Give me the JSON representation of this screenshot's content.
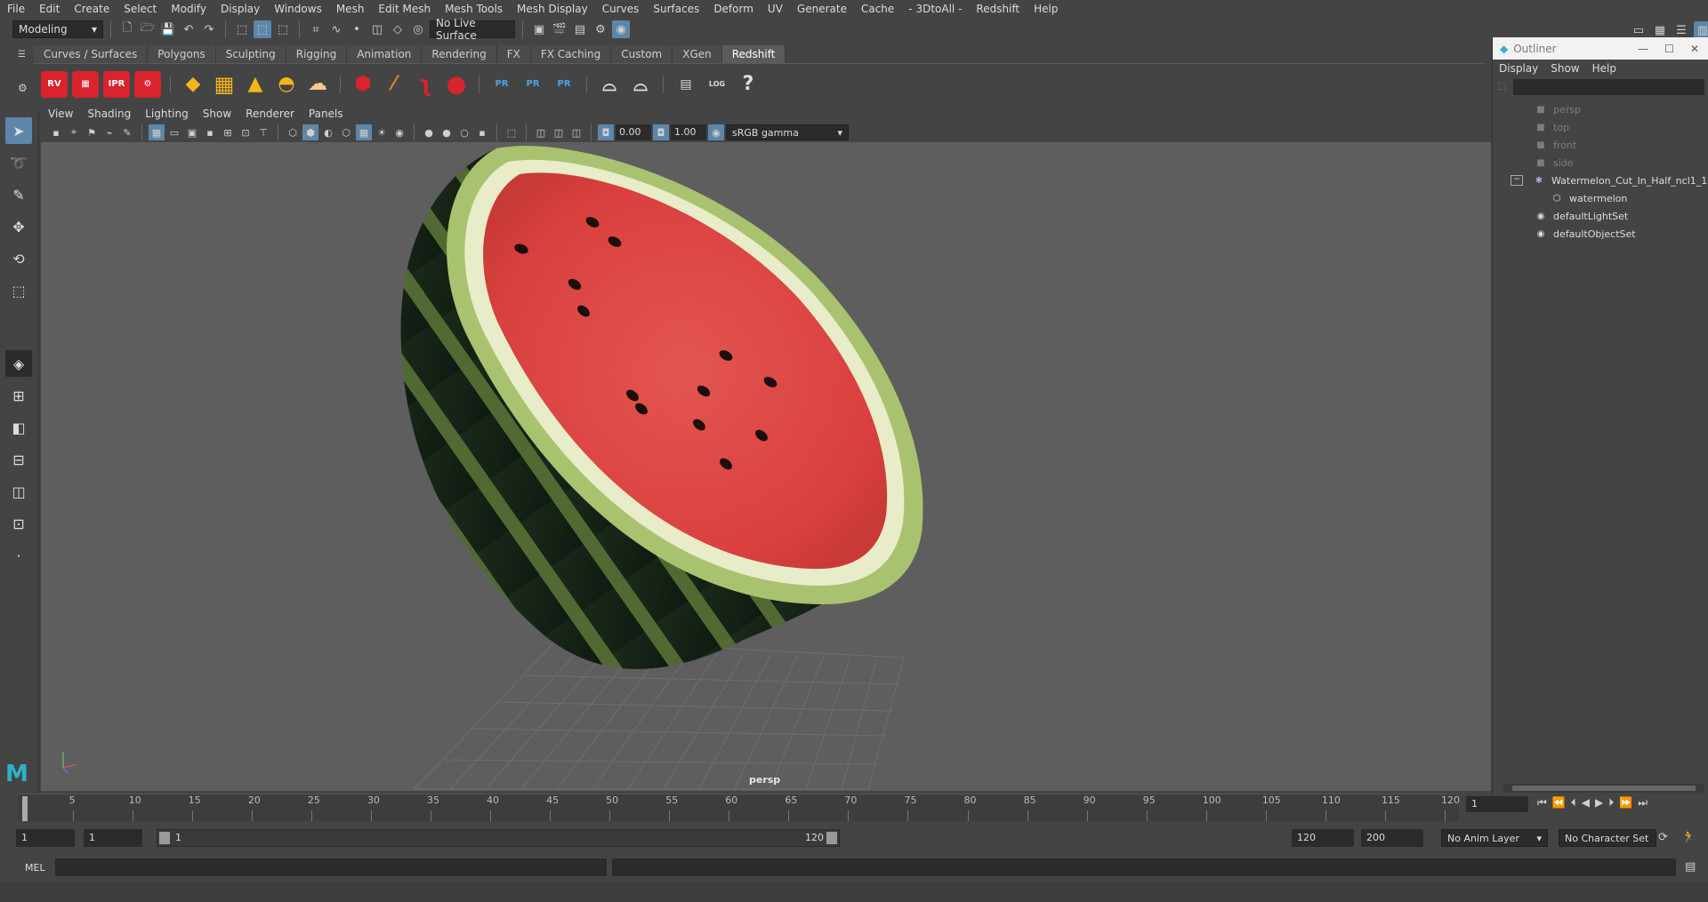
{
  "menubar": [
    "File",
    "Edit",
    "Create",
    "Select",
    "Modify",
    "Display",
    "Windows",
    "Mesh",
    "Edit Mesh",
    "Mesh Tools",
    "Mesh Display",
    "Curves",
    "Surfaces",
    "Deform",
    "UV",
    "Generate",
    "Cache",
    "- 3DtoAll -",
    "Redshift",
    "Help"
  ],
  "status": {
    "workspace": "Modeling",
    "live_surface": "No Live Surface"
  },
  "shelf_tabs": [
    "Curves / Surfaces",
    "Polygons",
    "Sculpting",
    "Rigging",
    "Animation",
    "Rendering",
    "FX",
    "FX Caching",
    "Custom",
    "XGen",
    "Redshift"
  ],
  "shelf_active": "Redshift",
  "shelf_icons": {
    "rv": "RV",
    "ipr": "IPR",
    "pr1": "PR",
    "pr2": "PR",
    "pr3": "PR",
    "log": "LOG",
    "help": "?"
  },
  "panel_menu": [
    "View",
    "Shading",
    "Lighting",
    "Show",
    "Renderer",
    "Panels"
  ],
  "panel_toolbar": {
    "exposure": "0.00",
    "gamma": "1.00",
    "color_space": "sRGB gamma"
  },
  "viewport": {
    "camera": "persp"
  },
  "outliner": {
    "title": "Outliner",
    "menu": [
      "Display",
      "Show",
      "Help"
    ],
    "items": [
      {
        "label": "persp",
        "icon": "camera-icon",
        "dim": true
      },
      {
        "label": "top",
        "icon": "camera-icon",
        "dim": true
      },
      {
        "label": "front",
        "icon": "camera-icon",
        "dim": true
      },
      {
        "label": "side",
        "icon": "camera-icon",
        "dim": true
      },
      {
        "label": "Watermelon_Cut_In_Half_ncl1_1",
        "icon": "group-icon",
        "dim": false
      },
      {
        "label": "watermelon",
        "icon": "mesh-icon",
        "dim": false
      },
      {
        "label": "defaultLightSet",
        "icon": "set-icon",
        "dim": false
      },
      {
        "label": "defaultObjectSet",
        "icon": "set-icon",
        "dim": false
      }
    ]
  },
  "timeline": {
    "ticks": [
      "1",
      "5",
      "10",
      "15",
      "20",
      "25",
      "30",
      "35",
      "40",
      "45",
      "50",
      "55",
      "60",
      "65",
      "70",
      "75",
      "80",
      "85",
      "90",
      "95",
      "100",
      "105",
      "110",
      "115",
      "120"
    ],
    "current_frame": "1"
  },
  "range": {
    "start": "1",
    "playback_start": "1",
    "slider_start": "1",
    "slider_end": "120",
    "playback_end": "120",
    "end": "200",
    "anim_layer": "No Anim Layer",
    "character_set": "No Character Set"
  },
  "cmdline": {
    "lang": "MEL"
  },
  "colors": {
    "accent": "#5d86a8",
    "viewport_bg": "#5e5e5e",
    "redshift_red": "#d9232d"
  }
}
